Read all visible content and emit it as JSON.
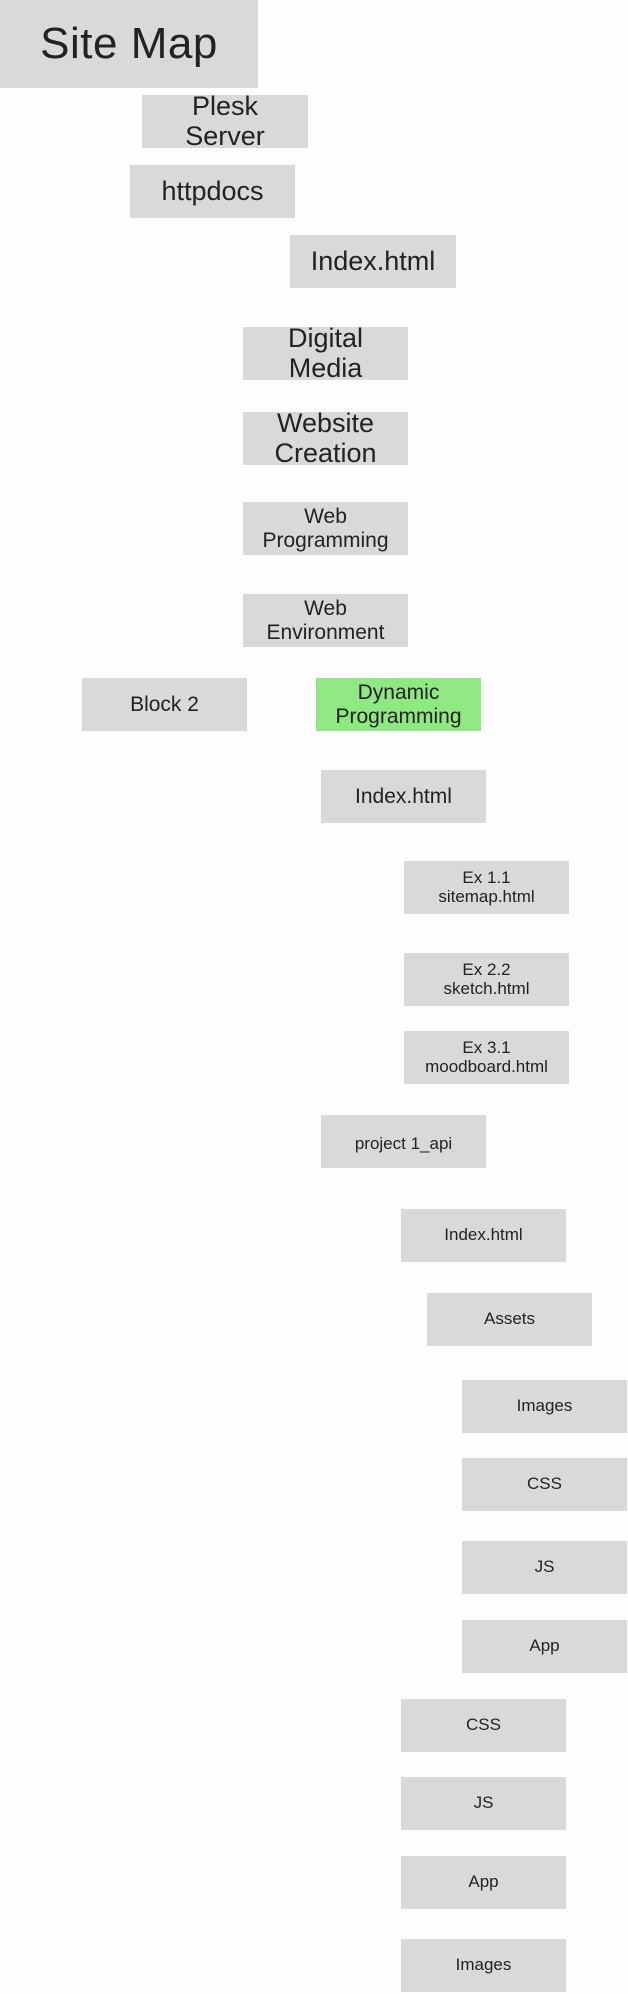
{
  "title": "Site Map",
  "colors": {
    "node_fill": "#d9d9d9",
    "highlight_fill": "#90e882",
    "text": "#222222",
    "background": "#fdfdfd"
  },
  "nodes": {
    "plesk_server": "Plesk\nServer",
    "httpdocs": "httpdocs",
    "index_root": "Index.html",
    "digital_media": "Digital\nMedia",
    "website_creation": "Website\nCreation",
    "web_programming": "Web\nProgramming",
    "web_environment": "Web\nEnvironment",
    "block_2": "Block 2",
    "dynamic_programming": "Dynamic\nProgramming",
    "index_dynamic": "Index.html",
    "ex_1_1": "Ex 1.1\nsitemap.html",
    "ex_2_2": "Ex 2.2\nsketch.html",
    "ex_3_1": "Ex 3.1\nmoodboard.html",
    "project_1_api": "project 1_api",
    "index_project": "Index.html",
    "assets": "Assets",
    "assets_images": "Images",
    "assets_css": "CSS",
    "assets_js": "JS",
    "assets_app": "App",
    "project_css": "CSS",
    "project_js": "JS",
    "project_app": "App",
    "project_images": "Images"
  },
  "highlighted_node": "dynamic_programming"
}
